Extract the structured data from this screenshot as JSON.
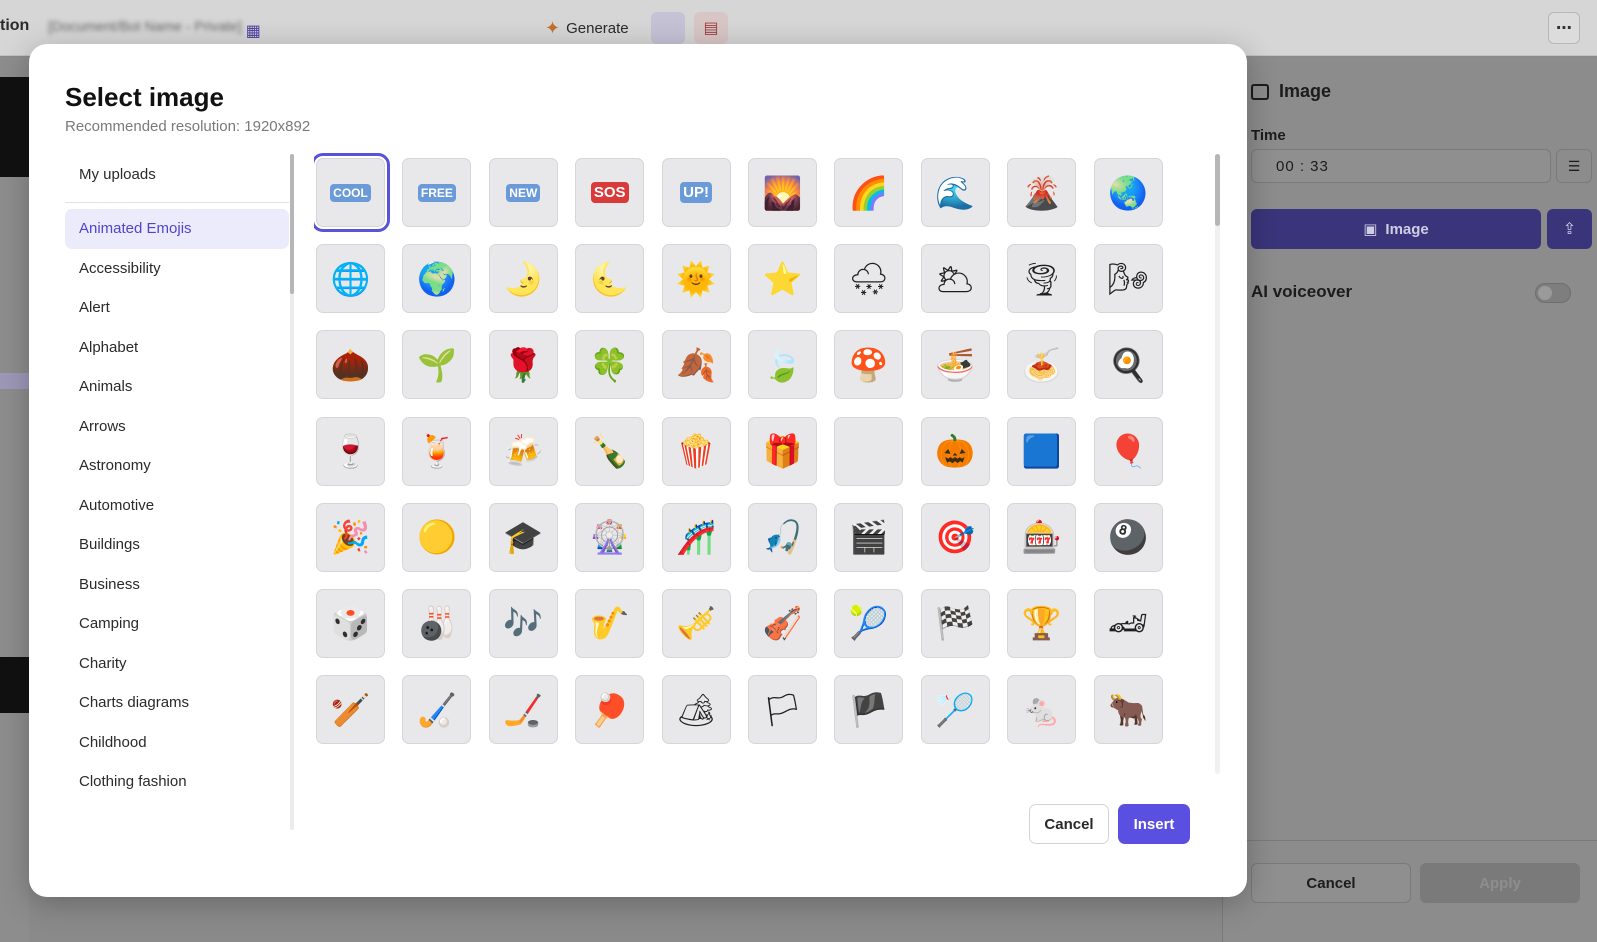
{
  "app": {
    "title": "tion",
    "doc_name": "[Document/Bot Name - Private]",
    "generate_label": "Generate",
    "more_label": "⋯"
  },
  "right_panel": {
    "title": "Image",
    "time_label": "Time",
    "time_value": "00 : 33",
    "image_button": "Image",
    "ai_voiceover_label": "AI voiceover",
    "ai_voiceover_on": false,
    "cancel_label": "Cancel",
    "apply_label": "Apply"
  },
  "modal": {
    "title": "Select image",
    "subtitle": "Recommended resolution: 1920x892",
    "categories": [
      "My uploads",
      "Animated Emojis",
      "Accessibility",
      "Alert",
      "Alphabet",
      "Animals",
      "Arrows",
      "Astronomy",
      "Automotive",
      "Buildings",
      "Business",
      "Camping",
      "Charity",
      "Charts diagrams",
      "Childhood",
      "Clothing fashion"
    ],
    "active_category": "Animated Emojis",
    "selected_index": 0,
    "emojis": [
      "COOL",
      "FREE",
      "NEW",
      "SOS",
      "UP!",
      "🌄",
      "🌈",
      "🌊",
      "🌋",
      "🌏",
      "🌐",
      "🌍",
      "🌛",
      "🌜",
      "🌞",
      "⭐",
      "🌨",
      "🌥",
      "🌪",
      "🌬",
      "🌰",
      "🌱",
      "🌹",
      "🍀",
      "🍂",
      "🍃",
      "🍄",
      "🍜",
      "🍝",
      "🍳",
      "🍷",
      "🍹",
      "🍻",
      "🍾",
      "🍿",
      "🎁",
      "",
      "🎃",
      "🟦",
      "🎈",
      "🎉",
      "🟡",
      "🎓",
      "🎡",
      "🎢",
      "🎣",
      "🎬",
      "🎯",
      "🎰",
      "🎱",
      "🎲",
      "🎳",
      "🎶",
      "🎷",
      "🎺",
      "🎻",
      "🎾",
      "🏁",
      "🏆",
      "🏎",
      "🏏",
      "🏑",
      "🏒",
      "🏓",
      "🏕",
      "🏳",
      "🏴",
      "🏸",
      "🐁",
      "🐂"
    ],
    "cancel_label": "Cancel",
    "insert_label": "Insert"
  }
}
